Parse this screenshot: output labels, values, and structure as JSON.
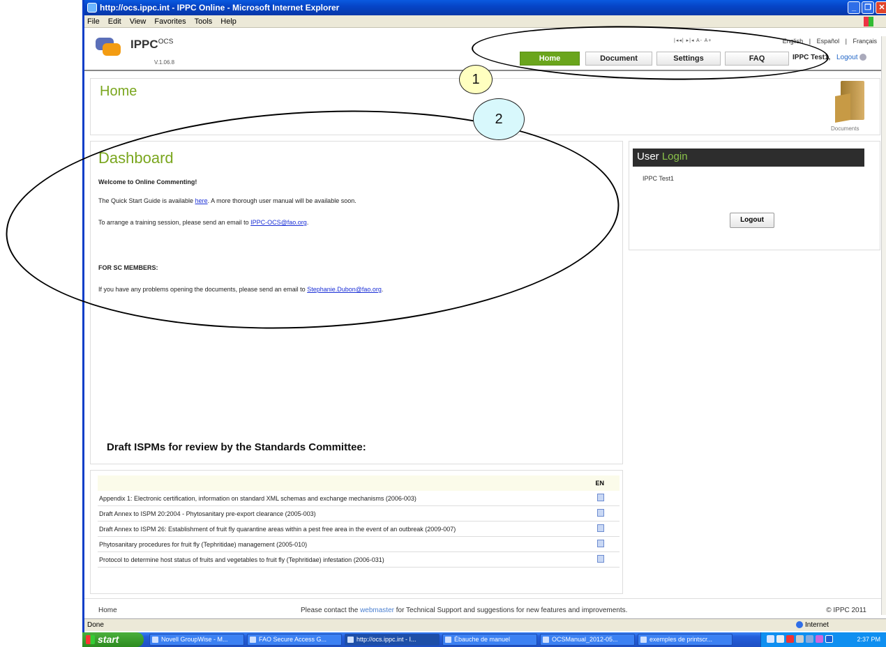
{
  "window": {
    "title": "http://ocs.ippc.int - IPPC Online - Microsoft Internet Explorer",
    "menu": [
      "File",
      "Edit",
      "View",
      "Favorites",
      "Tools",
      "Help"
    ]
  },
  "header": {
    "logo": "IPPC",
    "logo_sup": "OCS",
    "version": "V.1.06.8",
    "font_controls": "|◂◂|  ▸|◂  A-  A+",
    "languages": [
      "English",
      "|",
      "Español",
      "|",
      "Français"
    ],
    "nav": [
      "Home",
      "Document",
      "Settings",
      "FAQ"
    ],
    "user": "IPPC Test1,",
    "logout": "Logout"
  },
  "home": {
    "title": "Home",
    "documents_label": "Documents"
  },
  "dashboard": {
    "title": "Dashboard",
    "welcome": "Welcome to Online Commenting!",
    "quick_pre": "The Quick Start Guide is available ",
    "quick_link": "here",
    "quick_post": ". A more thorough user manual will be available soon.",
    "training_pre": "To arrange a training session, please send an email to ",
    "training_link": "IPPC-OCS@fao.org",
    "training_post": ".",
    "sc_head": "FOR SC MEMBERS:",
    "sc_pre": "If you have any problems opening the documents, please send an email to ",
    "sc_link": "Stephanie.Dubon@fao.org",
    "sc_post": "."
  },
  "user_login": {
    "head_a": "User ",
    "head_b": "Login",
    "name": "IPPC Test1",
    "logout_button": "Logout"
  },
  "drafts": {
    "heading": "Draft ISPMs for review by the Standards Committee:",
    "col_header": "EN",
    "rows": [
      "Appendix 1: Electronic certification, information on standard XML schemas and exchange mechanisms (2006-003)",
      "Draft Annex to ISPM 20:2004 - Phytosanitary pre-export clearance (2005-003)",
      "Draft Annex to ISPM 26: Establishment of fruit fly quarantine areas within a pest free area in the event of an outbreak (2009-007)",
      "Phytosanitary procedures for fruit fly (Tephritidae) management (2005-010)",
      "Protocol to determine host status of fruits and vegetables to fruit fly (Tephritidae) infestation (2006-031)"
    ]
  },
  "footer": {
    "home": "Home",
    "contact_pre": "Please contact the ",
    "contact_link": "webmaster",
    "contact_post": " for Technical Support and suggestions for new features and improvements.",
    "copyright": "© IPPC 2011"
  },
  "status": {
    "left": "Done",
    "zone": "Internet"
  },
  "taskbar": {
    "start": "start",
    "tasks": [
      "Novell GroupWise - M...",
      "FAO Secure Access G...",
      "http://ocs.ippc.int - I...",
      "Ébauche de manuel",
      "OCSManual_2012-05...",
      "exemples de printscr..."
    ],
    "clock": "2:37 PM"
  },
  "callouts": [
    "1",
    "2"
  ],
  "colors": {
    "accent_green": "#7aa61e",
    "nav_active": "#6aa51c",
    "callout_1": "#ffffc0",
    "callout_2": "#d8f8fc"
  }
}
